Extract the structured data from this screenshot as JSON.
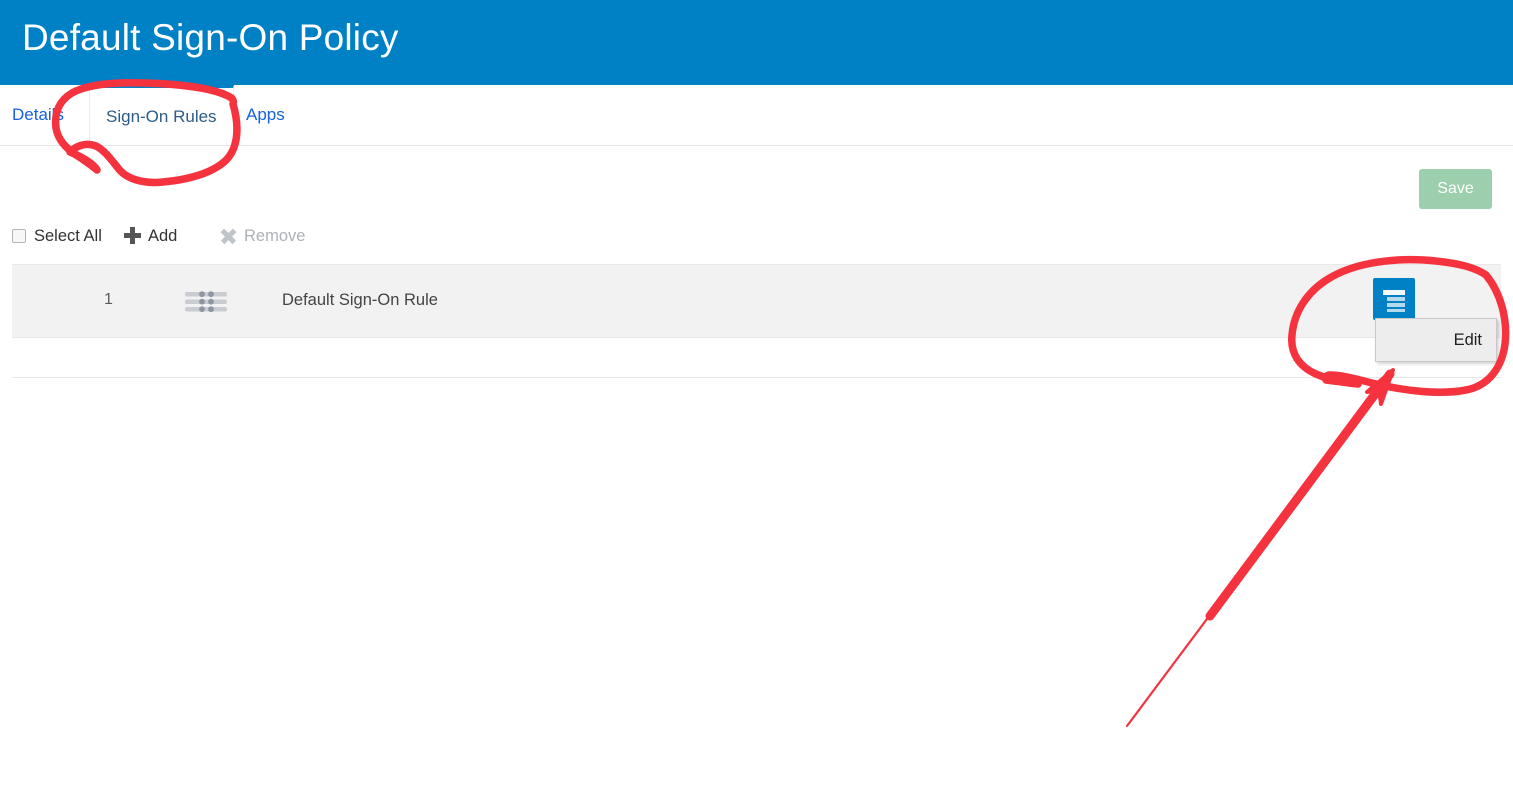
{
  "header": {
    "title": "Default Sign-On Policy",
    "background_color": "#0081c6"
  },
  "tabs": [
    {
      "label": "Details",
      "active": false
    },
    {
      "label": "Sign-On Rules",
      "active": true
    },
    {
      "label": "Apps",
      "active": false
    }
  ],
  "actions": {
    "save_label": "Save",
    "save_color": "#9ccfae"
  },
  "toolbar": {
    "select_all_label": "Select All",
    "select_all_checked": false,
    "add_label": "Add",
    "add_icon": "plus-icon",
    "remove_label": "Remove",
    "remove_icon": "close-icon",
    "remove_disabled": true
  },
  "rules_table": {
    "rows": [
      {
        "index": "1",
        "handle_icon": "drag-handle-icon",
        "name": "Default Sign-On Rule",
        "actions_icon": "list-menu-icon",
        "actions_color": "#0081c6"
      }
    ]
  },
  "context_menu": {
    "visible": true,
    "items": [
      {
        "label": "Edit"
      }
    ]
  },
  "annotations": {
    "color": "#f5333f",
    "shapes": [
      {
        "type": "ellipse",
        "target": "sign-on-rules-tab"
      },
      {
        "type": "ellipse",
        "target": "row-actions-and-edit-menu"
      },
      {
        "type": "arrow",
        "target": "edit-menu"
      }
    ]
  }
}
